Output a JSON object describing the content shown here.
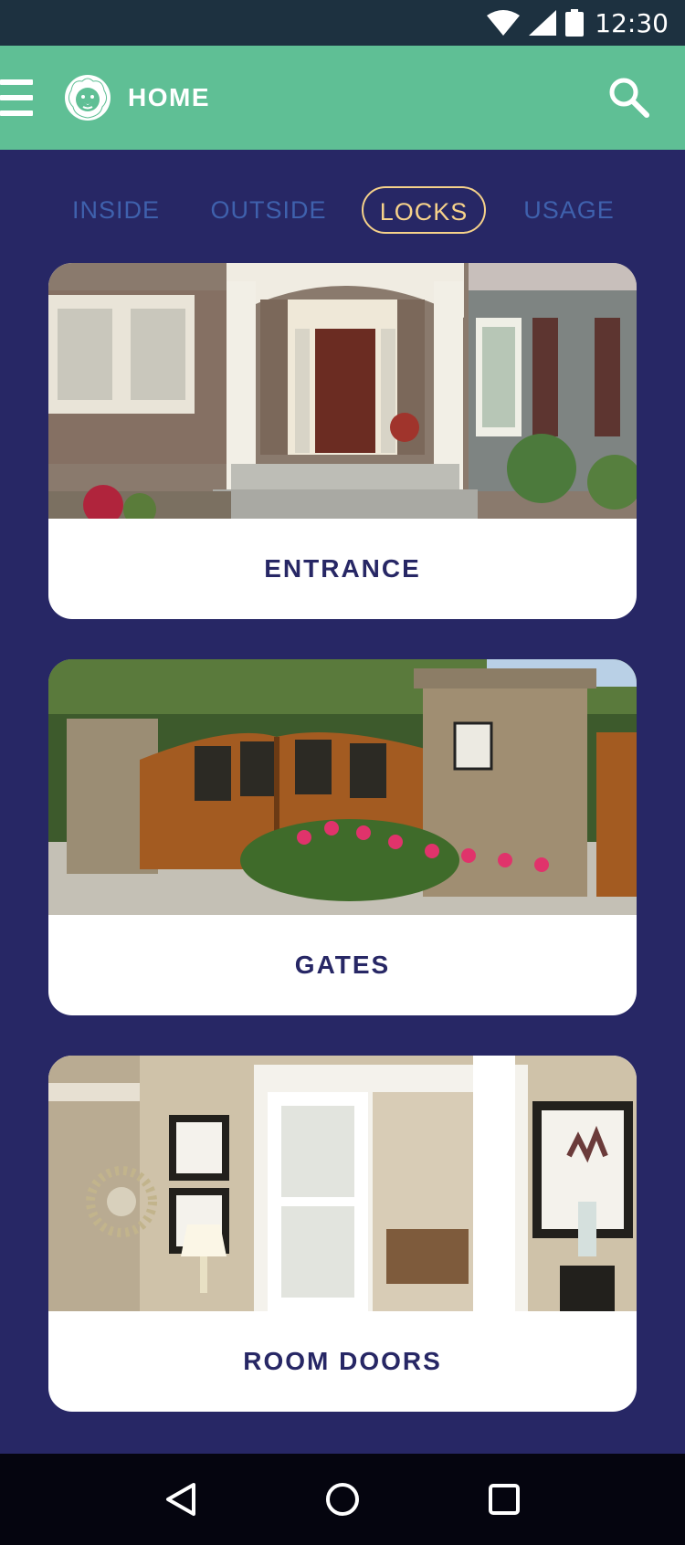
{
  "status_bar": {
    "time": "12:30",
    "icons": [
      "wifi-icon",
      "signal-icon",
      "battery-icon"
    ]
  },
  "app_bar": {
    "title": "HOME",
    "icons": [
      "menu-icon",
      "lion-logo-icon",
      "search-icon"
    ]
  },
  "tabs": [
    {
      "label": "INSIDE",
      "active": false
    },
    {
      "label": "OUTSIDE",
      "active": false
    },
    {
      "label": "LOCKS",
      "active": true
    },
    {
      "label": "USAGE",
      "active": false
    }
  ],
  "cards": [
    {
      "label": "ENTRANCE",
      "image": "house-entrance-photo"
    },
    {
      "label": "GATES",
      "image": "wooden-gates-photo"
    },
    {
      "label": "ROOM DOORS",
      "image": "room-doors-photo"
    }
  ],
  "nav_bar": {
    "icons": [
      "back-icon",
      "home-icon",
      "recents-icon"
    ]
  },
  "colors": {
    "background": "#272765",
    "app_bar": "#5fbf95",
    "status_bar": "#1d3140",
    "tab_inactive": "#3f61ad",
    "tab_active": "#f6d28a",
    "card_text": "#272765"
  }
}
